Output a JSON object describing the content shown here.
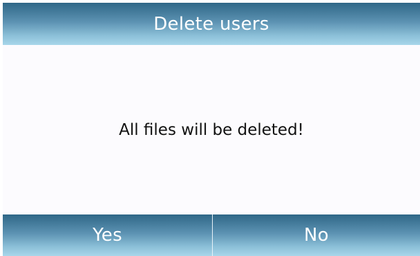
{
  "dialog": {
    "title": "Delete users",
    "message": "All files will be deleted!",
    "yes_label": "Yes",
    "no_label": "No"
  },
  "colors": {
    "header_top": "#2f6787",
    "header_bottom": "#a8d6ea",
    "body_background": "#fcfbfe",
    "text": "#111111"
  }
}
